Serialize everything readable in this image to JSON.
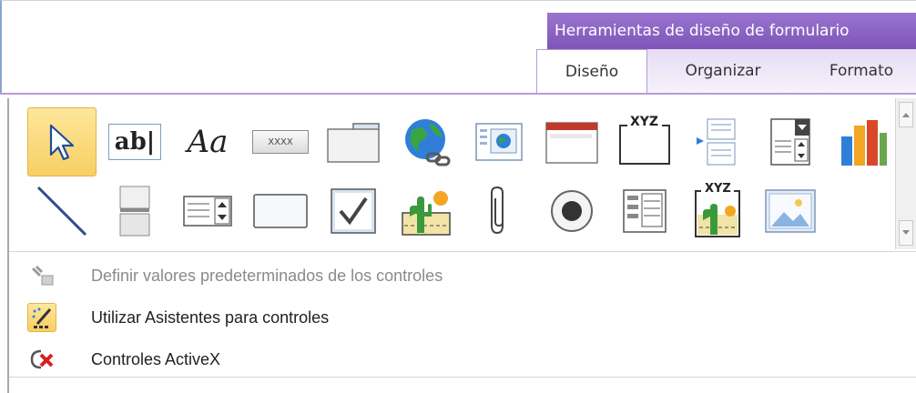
{
  "ribbon": {
    "context_header": "Herramientas de diseño de formulario",
    "tabs": [
      {
        "label": "Diseño"
      },
      {
        "label": "Organizar"
      },
      {
        "label": "Formato"
      }
    ]
  },
  "gallery": {
    "controls": [
      {
        "name": "select-pointer-icon",
        "selected": true
      },
      {
        "name": "textbox-icon",
        "text": "ab|"
      },
      {
        "name": "label-icon",
        "text": "Aa"
      },
      {
        "name": "button-icon",
        "text": "XXXX"
      },
      {
        "name": "tab-control-icon"
      },
      {
        "name": "hyperlink-icon"
      },
      {
        "name": "web-browser-icon"
      },
      {
        "name": "navigation-control-icon"
      },
      {
        "name": "option-group-icon",
        "text": "XYZ"
      },
      {
        "name": "insert-page-break-icon"
      },
      {
        "name": "combo-box-icon"
      },
      {
        "name": "chart-icon"
      },
      {
        "name": "line-icon"
      },
      {
        "name": "toggle-button-icon"
      },
      {
        "name": "list-box-icon"
      },
      {
        "name": "rectangle-icon"
      },
      {
        "name": "check-box-icon"
      },
      {
        "name": "unbound-object-frame-icon"
      },
      {
        "name": "attachment-icon"
      },
      {
        "name": "option-button-icon"
      },
      {
        "name": "subform-icon"
      },
      {
        "name": "bound-object-frame-icon",
        "text": "XYZ"
      },
      {
        "name": "image-icon"
      }
    ],
    "menu": [
      {
        "label": "Definir valores predeterminados de los controles",
        "icon": "set-defaults-icon",
        "enabled": false
      },
      {
        "label": "Utilizar Asistentes para controles",
        "icon": "control-wizard-icon",
        "enabled": true
      },
      {
        "label": "Controles ActiveX",
        "icon": "activex-icon",
        "enabled": true
      }
    ]
  },
  "colors": {
    "context_purple": "#8a63c4",
    "selected_gold": "#f8cf63"
  }
}
